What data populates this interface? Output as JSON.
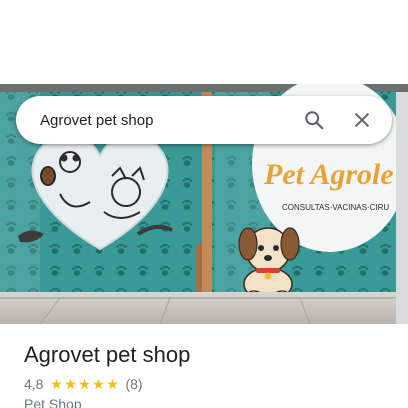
{
  "search": {
    "query": "Agrovet pet shop"
  },
  "photo": {
    "sign_text": "Pet Agrole",
    "sign_subtext": "CONSULTAS·VACINAS·CIRU"
  },
  "place": {
    "title": "Agrovet pet shop",
    "rating": "4,8",
    "stars": 5,
    "review_count": "(8)",
    "category": "Pet Shop"
  },
  "colors": {
    "star": "#fbbc04",
    "window_teal": "#3f9e9c",
    "sign_orange": "#e8a23a"
  }
}
